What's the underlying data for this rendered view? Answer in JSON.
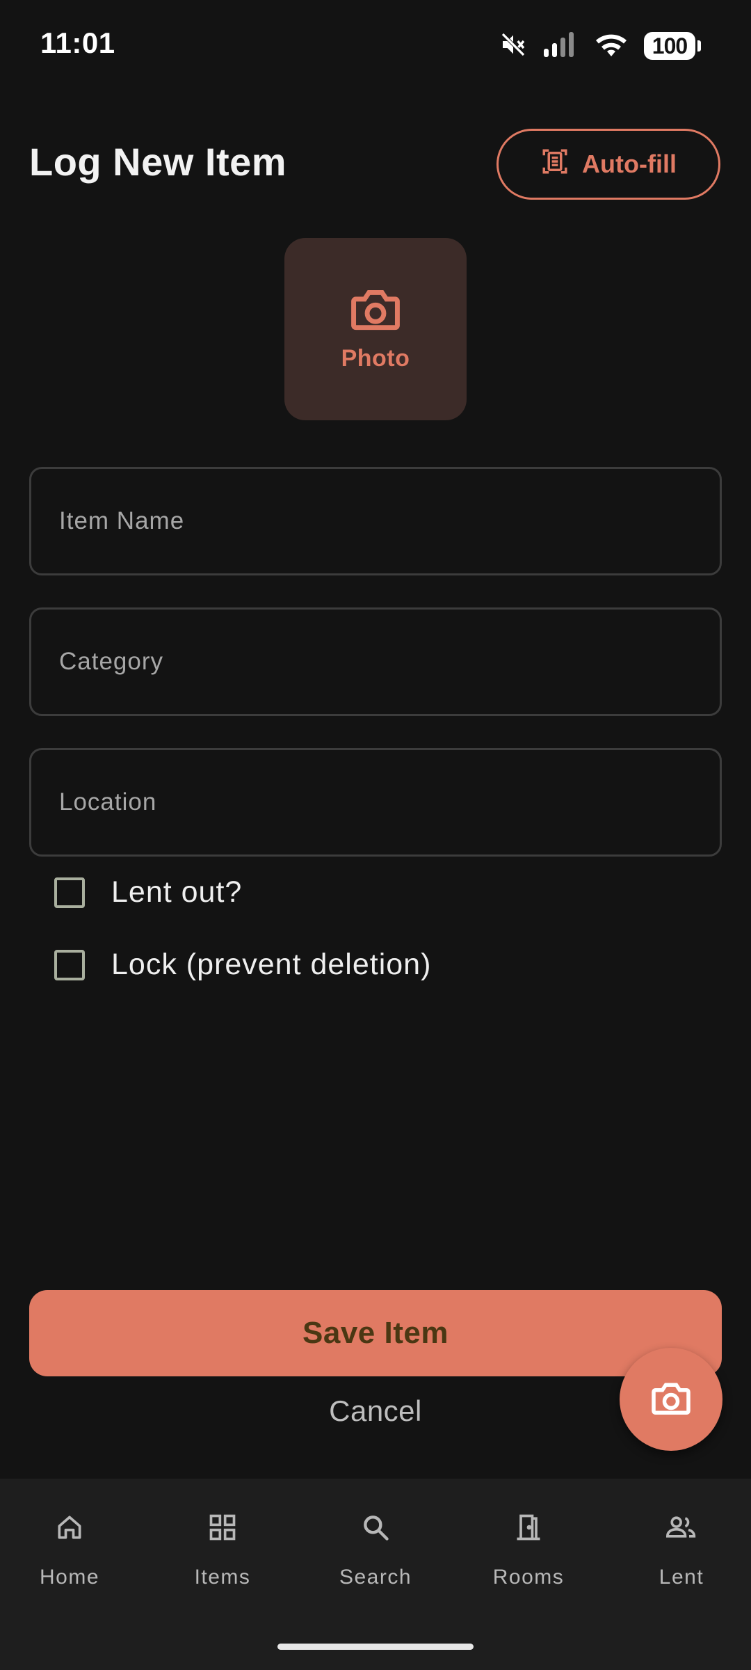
{
  "status_bar": {
    "time": "11:01",
    "battery": "100",
    "icons": [
      "mute-icon",
      "signal-icon",
      "wifi-icon",
      "battery-icon"
    ]
  },
  "header": {
    "title": "Log New Item",
    "autofill_label": "Auto-fill",
    "autofill_icon": "document-scan-icon"
  },
  "photo": {
    "label": "Photo",
    "icon": "camera-icon"
  },
  "form": {
    "item_name": {
      "placeholder": "Item Name",
      "value": ""
    },
    "category": {
      "placeholder": "Category",
      "value": ""
    },
    "location": {
      "placeholder": "Location",
      "value": ""
    },
    "lent_out": {
      "label": "Lent out?",
      "checked": false
    },
    "lock": {
      "label": "Lock (prevent deletion)",
      "checked": false
    }
  },
  "actions": {
    "save_label": "Save Item",
    "cancel_label": "Cancel"
  },
  "fab": {
    "icon": "camera-icon"
  },
  "nav": {
    "items": [
      {
        "label": "Home",
        "icon": "home-icon"
      },
      {
        "label": "Items",
        "icon": "grid-icon"
      },
      {
        "label": "Search",
        "icon": "search-icon"
      },
      {
        "label": "Rooms",
        "icon": "door-icon"
      },
      {
        "label": "Lent",
        "icon": "people-icon"
      }
    ]
  },
  "colors": {
    "background": "#131313",
    "accent": "#E07A63",
    "photo_tile": "#3C2B28",
    "save_text": "#4A3713",
    "nav_background": "#1E1E1E"
  }
}
